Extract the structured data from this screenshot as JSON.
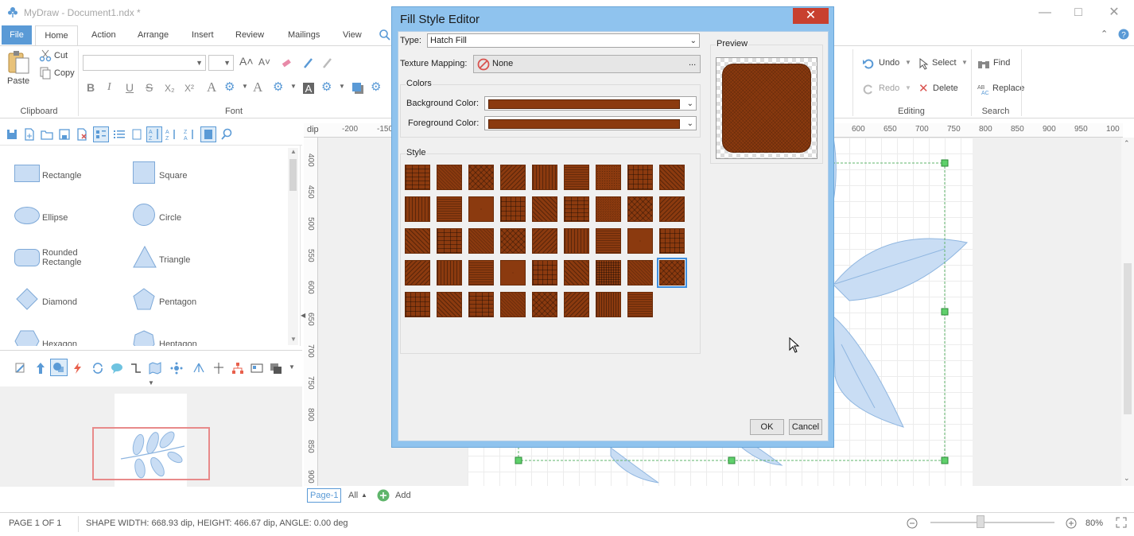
{
  "window": {
    "title": "MyDraw - Document1.ndx *"
  },
  "tabs": [
    "File",
    "Home",
    "Action",
    "Arrange",
    "Insert",
    "Review",
    "Mailings",
    "View"
  ],
  "ribbon": {
    "clipboard": {
      "paste": "Paste",
      "cut": "Cut",
      "copy": "Copy",
      "label": "Clipboard"
    },
    "font": {
      "label": "Font"
    },
    "editing": {
      "undo": "Undo",
      "redo": "Redo",
      "select": "Select",
      "delete": "Delete",
      "label": "Editing"
    },
    "search": {
      "find": "Find",
      "replace": "Replace",
      "label": "Search"
    }
  },
  "shapes": [
    {
      "label": "Rectangle",
      "icon": "rectangle-icon"
    },
    {
      "label": "Square",
      "icon": "square-icon"
    },
    {
      "label": "Ellipse",
      "icon": "ellipse-icon"
    },
    {
      "label": "Circle",
      "icon": "circle-icon"
    },
    {
      "label": "Rounded Rectangle",
      "icon": "rounded-rectangle-icon"
    },
    {
      "label": "Triangle",
      "icon": "triangle-icon"
    },
    {
      "label": "Diamond",
      "icon": "diamond-icon"
    },
    {
      "label": "Pentagon",
      "icon": "pentagon-icon"
    },
    {
      "label": "Hexagon",
      "icon": "hexagon-icon"
    },
    {
      "label": "Heptagon",
      "icon": "heptagon-icon"
    }
  ],
  "ruler": {
    "unit": "dip",
    "h_ticks": [
      "-200",
      "-150",
      "600",
      "650",
      "700",
      "750",
      "800",
      "850",
      "900",
      "950",
      "100"
    ],
    "v_ticks": [
      "400",
      "450",
      "500",
      "550",
      "600",
      "650",
      "700",
      "750",
      "800",
      "850",
      "900"
    ]
  },
  "pagebar": {
    "page": "Page-1",
    "all": "All",
    "add": "Add"
  },
  "status": {
    "page": "PAGE 1 OF 1",
    "shape": "SHAPE WIDTH: 668.93 dip, HEIGHT: 466.67 dip, ANGLE: 0.00 deg",
    "zoom": "80%",
    "zoom_level": 0.4
  },
  "dialog": {
    "title": "Fill Style Editor",
    "type_label": "Type:",
    "type_value": "Hatch Fill",
    "texture_label": "Texture Mapping:",
    "texture_value": "None",
    "texture_btn": "...",
    "colors_title": "Colors",
    "bg_label": "Background Color:",
    "fg_label": "Foreground Color:",
    "style_title": "Style",
    "preview_title": "Preview",
    "ok": "OK",
    "cancel": "Cancel",
    "swatch_color": "#8b3a0f",
    "swatch_count": 44,
    "selected_index": 35
  }
}
